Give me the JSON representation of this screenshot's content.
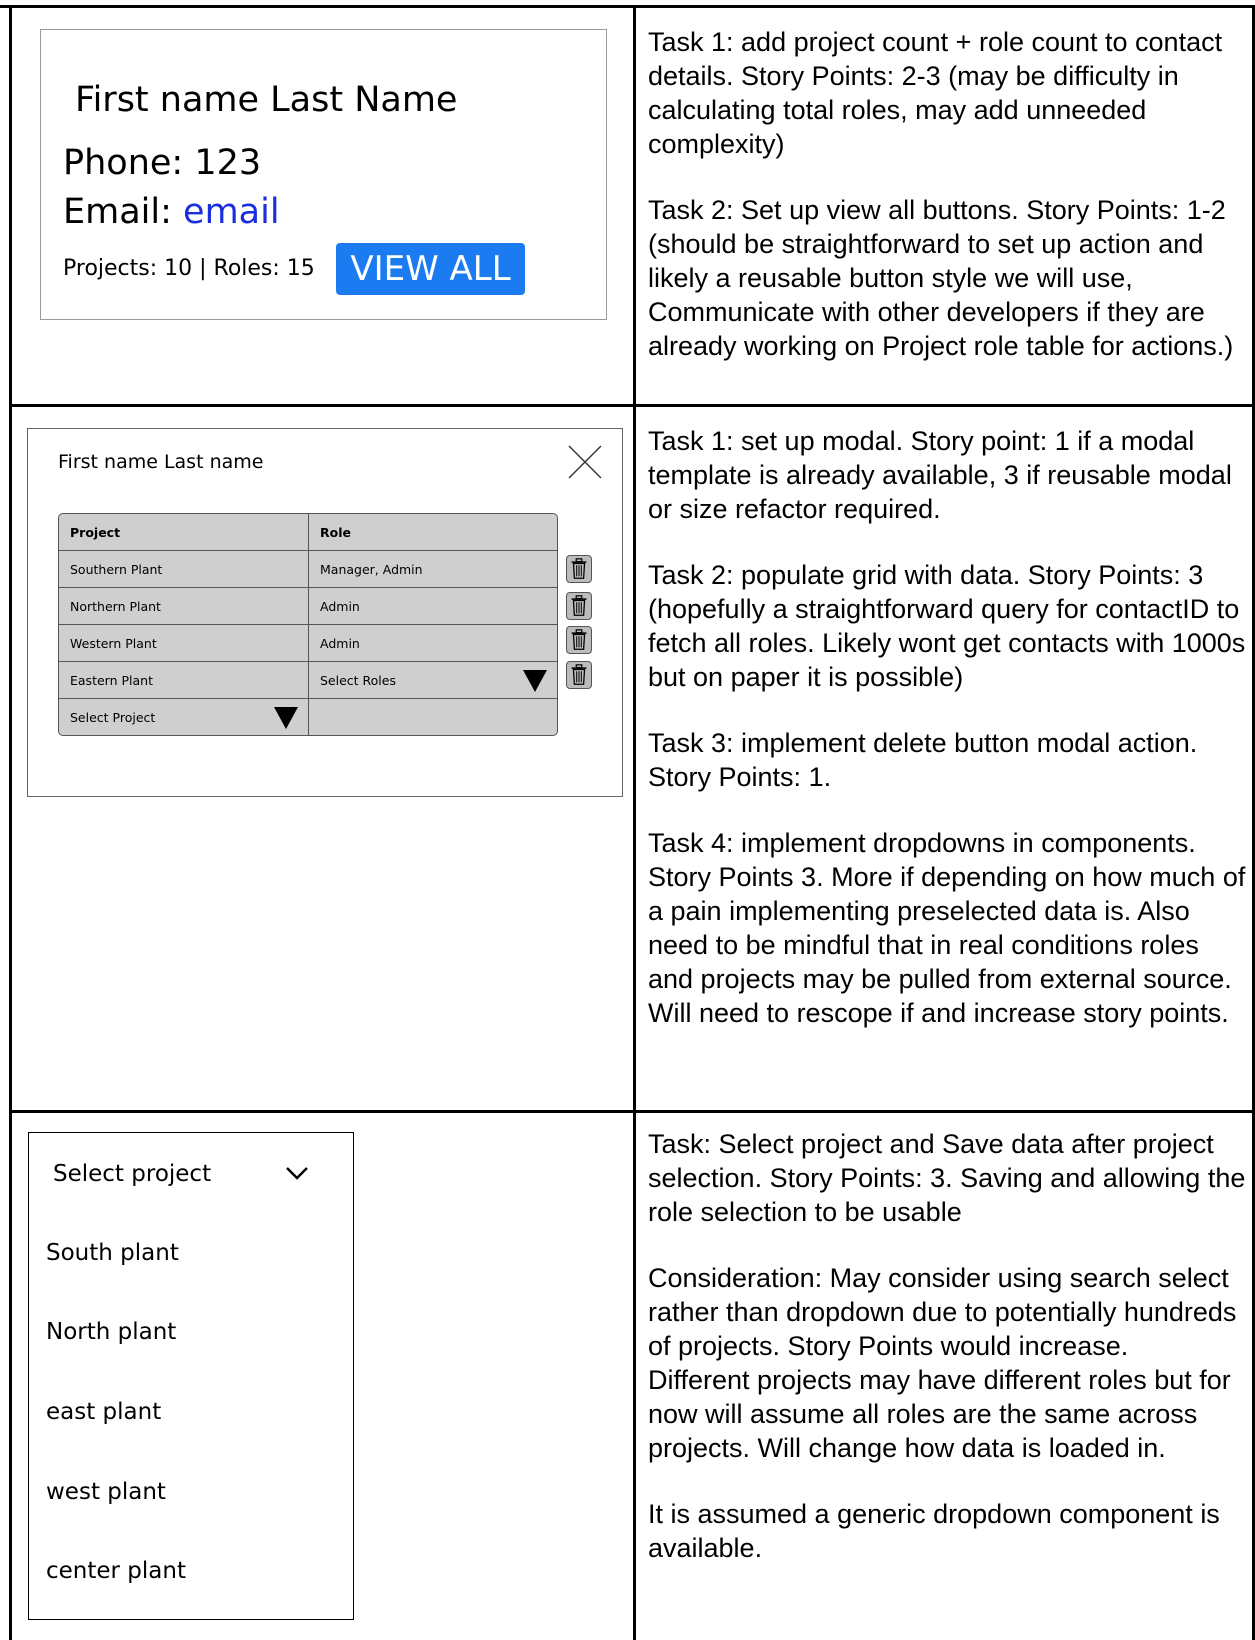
{
  "section1": {
    "card": {
      "name": "First name Last Name",
      "phone": "Phone: 123",
      "email_label": "Email: ",
      "email_link": "email",
      "counts": "Projects: 10 | Roles: 15",
      "button": "VIEW ALL"
    },
    "notes": [
      "Task 1: add project count + role count to contact details. Story Points: 2-3 (may be difficulty in calculating total roles, may add unneeded complexity)",
      "Task 2: Set up view all buttons. Story Points: 1-2 (should be straightforward to set up action and likely a reusable button style we will use, Communicate with other developers if they are already working on Project role table for actions.)"
    ]
  },
  "section2": {
    "modal": {
      "title": "First name Last name",
      "headers": [
        "Project",
        "Role"
      ],
      "rows": [
        [
          "Southern Plant",
          "Manager, Admin"
        ],
        [
          "Northern Plant",
          "Admin"
        ],
        [
          "Western Plant",
          "Admin"
        ],
        [
          "Eastern Plant",
          "Select Roles"
        ],
        [
          "Select Project",
          ""
        ]
      ]
    },
    "notes": [
      "Task 1: set up modal. Story point: 1 if a modal template is already available, 3 if reusable modal or size refactor required.",
      "Task 2: populate grid with data. Story Points: 3 (hopefully a straightforward query for contactID to fetch all roles. Likely wont get contacts with 1000s but on paper it is possible)",
      "Task 3: implement delete button modal action. Story Points: 1.",
      "Task 4: implement dropdowns in components. Story Points 3. More if depending on how much of a pain implementing preselected data is. Also need to be mindful that in real conditions roles and projects may be pulled from external source. Will need to rescope if and increase story points."
    ]
  },
  "section3": {
    "dropdown": {
      "label": "Select project",
      "items": [
        "South plant",
        "North plant",
        "east plant",
        "west plant",
        "center plant"
      ]
    },
    "notes": [
      "Task: Select project and Save data after project selection. Story Points: 3. Saving and allowing the role selection to be usable",
      "Consideration: May consider using search select rather than dropdown due to potentially hundreds of projects. Story Points would increase.",
      "Different projects may have different roles but for now will assume all roles are the same across projects. Will change how data is loaded in.",
      "It is assumed a generic dropdown component is available."
    ]
  },
  "icons": {
    "close": "close-icon",
    "trash": "trash-icon",
    "dropdown_arrow": "triangle-down-icon",
    "chevron": "chevron-down-icon"
  },
  "colors": {
    "link": "#1a2ee0",
    "button": "#1a7cf0",
    "table_bg": "#cfcfcf"
  }
}
